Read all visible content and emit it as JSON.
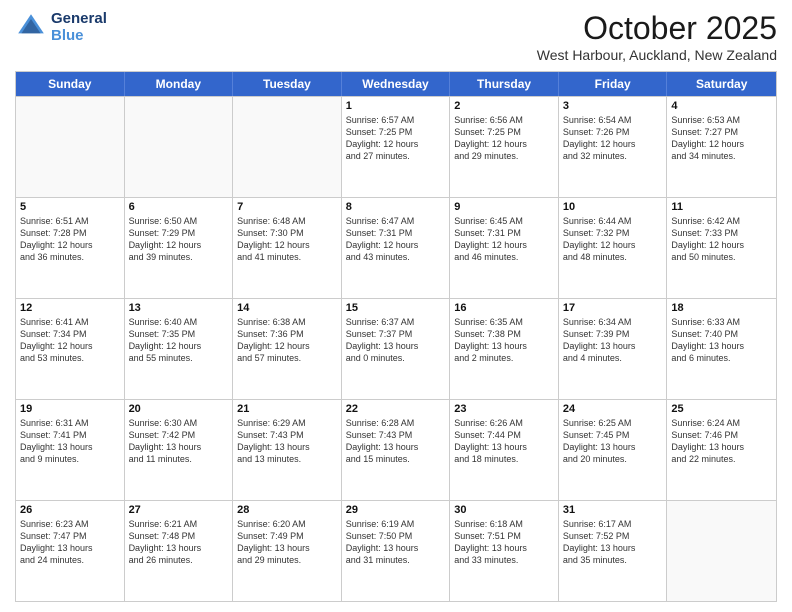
{
  "logo": {
    "line1": "General",
    "line2": "Blue"
  },
  "title": "October 2025",
  "subtitle": "West Harbour, Auckland, New Zealand",
  "days": [
    "Sunday",
    "Monday",
    "Tuesday",
    "Wednesday",
    "Thursday",
    "Friday",
    "Saturday"
  ],
  "weeks": [
    [
      {
        "day": "",
        "info": ""
      },
      {
        "day": "",
        "info": ""
      },
      {
        "day": "",
        "info": ""
      },
      {
        "day": "1",
        "info": "Sunrise: 6:57 AM\nSunset: 7:25 PM\nDaylight: 12 hours\nand 27 minutes."
      },
      {
        "day": "2",
        "info": "Sunrise: 6:56 AM\nSunset: 7:25 PM\nDaylight: 12 hours\nand 29 minutes."
      },
      {
        "day": "3",
        "info": "Sunrise: 6:54 AM\nSunset: 7:26 PM\nDaylight: 12 hours\nand 32 minutes."
      },
      {
        "day": "4",
        "info": "Sunrise: 6:53 AM\nSunset: 7:27 PM\nDaylight: 12 hours\nand 34 minutes."
      }
    ],
    [
      {
        "day": "5",
        "info": "Sunrise: 6:51 AM\nSunset: 7:28 PM\nDaylight: 12 hours\nand 36 minutes."
      },
      {
        "day": "6",
        "info": "Sunrise: 6:50 AM\nSunset: 7:29 PM\nDaylight: 12 hours\nand 39 minutes."
      },
      {
        "day": "7",
        "info": "Sunrise: 6:48 AM\nSunset: 7:30 PM\nDaylight: 12 hours\nand 41 minutes."
      },
      {
        "day": "8",
        "info": "Sunrise: 6:47 AM\nSunset: 7:31 PM\nDaylight: 12 hours\nand 43 minutes."
      },
      {
        "day": "9",
        "info": "Sunrise: 6:45 AM\nSunset: 7:31 PM\nDaylight: 12 hours\nand 46 minutes."
      },
      {
        "day": "10",
        "info": "Sunrise: 6:44 AM\nSunset: 7:32 PM\nDaylight: 12 hours\nand 48 minutes."
      },
      {
        "day": "11",
        "info": "Sunrise: 6:42 AM\nSunset: 7:33 PM\nDaylight: 12 hours\nand 50 minutes."
      }
    ],
    [
      {
        "day": "12",
        "info": "Sunrise: 6:41 AM\nSunset: 7:34 PM\nDaylight: 12 hours\nand 53 minutes."
      },
      {
        "day": "13",
        "info": "Sunrise: 6:40 AM\nSunset: 7:35 PM\nDaylight: 12 hours\nand 55 minutes."
      },
      {
        "day": "14",
        "info": "Sunrise: 6:38 AM\nSunset: 7:36 PM\nDaylight: 12 hours\nand 57 minutes."
      },
      {
        "day": "15",
        "info": "Sunrise: 6:37 AM\nSunset: 7:37 PM\nDaylight: 13 hours\nand 0 minutes."
      },
      {
        "day": "16",
        "info": "Sunrise: 6:35 AM\nSunset: 7:38 PM\nDaylight: 13 hours\nand 2 minutes."
      },
      {
        "day": "17",
        "info": "Sunrise: 6:34 AM\nSunset: 7:39 PM\nDaylight: 13 hours\nand 4 minutes."
      },
      {
        "day": "18",
        "info": "Sunrise: 6:33 AM\nSunset: 7:40 PM\nDaylight: 13 hours\nand 6 minutes."
      }
    ],
    [
      {
        "day": "19",
        "info": "Sunrise: 6:31 AM\nSunset: 7:41 PM\nDaylight: 13 hours\nand 9 minutes."
      },
      {
        "day": "20",
        "info": "Sunrise: 6:30 AM\nSunset: 7:42 PM\nDaylight: 13 hours\nand 11 minutes."
      },
      {
        "day": "21",
        "info": "Sunrise: 6:29 AM\nSunset: 7:43 PM\nDaylight: 13 hours\nand 13 minutes."
      },
      {
        "day": "22",
        "info": "Sunrise: 6:28 AM\nSunset: 7:43 PM\nDaylight: 13 hours\nand 15 minutes."
      },
      {
        "day": "23",
        "info": "Sunrise: 6:26 AM\nSunset: 7:44 PM\nDaylight: 13 hours\nand 18 minutes."
      },
      {
        "day": "24",
        "info": "Sunrise: 6:25 AM\nSunset: 7:45 PM\nDaylight: 13 hours\nand 20 minutes."
      },
      {
        "day": "25",
        "info": "Sunrise: 6:24 AM\nSunset: 7:46 PM\nDaylight: 13 hours\nand 22 minutes."
      }
    ],
    [
      {
        "day": "26",
        "info": "Sunrise: 6:23 AM\nSunset: 7:47 PM\nDaylight: 13 hours\nand 24 minutes."
      },
      {
        "day": "27",
        "info": "Sunrise: 6:21 AM\nSunset: 7:48 PM\nDaylight: 13 hours\nand 26 minutes."
      },
      {
        "day": "28",
        "info": "Sunrise: 6:20 AM\nSunset: 7:49 PM\nDaylight: 13 hours\nand 29 minutes."
      },
      {
        "day": "29",
        "info": "Sunrise: 6:19 AM\nSunset: 7:50 PM\nDaylight: 13 hours\nand 31 minutes."
      },
      {
        "day": "30",
        "info": "Sunrise: 6:18 AM\nSunset: 7:51 PM\nDaylight: 13 hours\nand 33 minutes."
      },
      {
        "day": "31",
        "info": "Sunrise: 6:17 AM\nSunset: 7:52 PM\nDaylight: 13 hours\nand 35 minutes."
      },
      {
        "day": "",
        "info": ""
      }
    ]
  ]
}
